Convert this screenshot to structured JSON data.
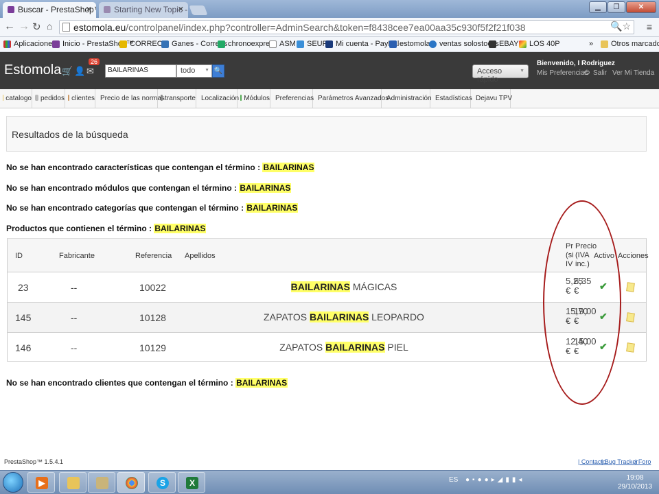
{
  "browser": {
    "tabs": [
      {
        "title": "Buscar - PrestaShop™",
        "active": true
      },
      {
        "title": "Starting New Topic - Pres",
        "active": false
      }
    ],
    "url_host": "estomola.eu",
    "url_path": "/controlpanel/index.php?controller=AdminSearch&token=f8438cee7ea00aa35c930f5f2f21f038",
    "bookmarks": [
      "Aplicaciones",
      "Inicio - PrestaShop™",
      "CORREOS",
      "Ganes - Correos",
      "chronoexpres",
      "ASM",
      "SEUR",
      "Mi cuenta - PayPal",
      "estomola",
      "ventas solostocks",
      "EBAY",
      "LOS 40P",
      "»",
      "Otros marcadores"
    ],
    "bookmark_icons": [
      "apps-icon",
      "prestashop-icon",
      "correos-icon",
      "correos-icon",
      "chronoexpres-icon",
      "page-icon",
      "seur-icon",
      "paypal-icon",
      "estomola-icon",
      "solostocks-icon",
      "ebay-icon",
      "los40-icon",
      "more-icon",
      "folder-icon"
    ]
  },
  "header": {
    "brand": "Estomola",
    "notifications": "26",
    "search_value": "BAILARINAS",
    "search_scope": "todo",
    "quick_access": "Acceso rápido",
    "welcome": "Bienvenido, I Rodriguez",
    "links": [
      "Mis Preferencias",
      "Salir",
      "Ver Mi Tienda"
    ]
  },
  "menu": [
    "catalogo",
    "pedidos",
    "clientes",
    "Precio de las normas",
    "transporte",
    "Localización",
    "Módulos",
    "Preferencias",
    "Parámetros Avanzados",
    "Administración",
    "Estadísticas",
    "Dejavu TPV"
  ],
  "panel_title": "Resultados de la búsqueda",
  "messages": {
    "features": "No se han encontrado características que contengan el término :",
    "modules": "No se han encontrado módulos que contengan el término :",
    "categories": "No se han encontrado categorías que contengan el término :",
    "products": "Productos que contienen el término :",
    "customers": "No se han encontrado clientes que contengan el término :",
    "term": "BAILARINAS"
  },
  "table": {
    "headers": {
      "id": "ID",
      "manufacturer": "Fabricante",
      "reference": "Referencia",
      "name": "Apellidos",
      "price_ex_a": "Pr",
      "price_ex_b": "(si",
      "price_ex_c": "IV",
      "price_inc_a": "Precio",
      "price_inc_b": "(IVA",
      "price_inc_c": "inc.)",
      "active": "Activo",
      "actions": "Acciones"
    },
    "rows": [
      {
        "id": "23",
        "manufacturer": "--",
        "reference": "10022",
        "name_before": "",
        "name_hl": "BAILARINAS",
        "name_after": " MÁGICAS",
        "price_ex": "5,25",
        "price_inc": "6,35",
        "currency": "€"
      },
      {
        "id": "145",
        "manufacturer": "--",
        "reference": "10128",
        "name_before": "ZAPATOS ",
        "name_hl": "BAILARINAS",
        "name_after": " LEOPARDO",
        "price_ex": "15,70",
        "price_inc": "19,00",
        "currency": "€"
      },
      {
        "id": "146",
        "manufacturer": "--",
        "reference": "10129",
        "name_before": "ZAPATOS ",
        "name_hl": "BAILARINAS",
        "name_after": " PIEL",
        "price_ex": "12,40",
        "price_inc": "15,00",
        "currency": "€"
      }
    ]
  },
  "footer": {
    "version": "PrestaShop™ 1.5.4.1",
    "links": [
      "| Contacto",
      "| Bug Tracker",
      "| Foro"
    ]
  },
  "taskbar": {
    "lang": "ES",
    "time": "19:08",
    "date": "29/10/2013"
  },
  "colors": {
    "highlight": "#ffff66",
    "annotation_oval": "#a61c1c",
    "header_bg": "#3a3a3a"
  }
}
